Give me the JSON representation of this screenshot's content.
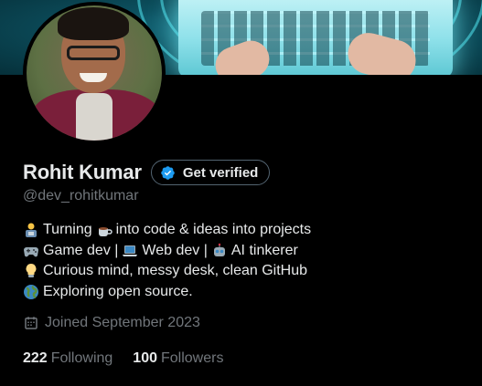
{
  "profile": {
    "display_name": "Rohit Kumar",
    "verify_label": "Get verified",
    "handle": "@dev_rohitkumar",
    "bio": [
      {
        "icon": "developer-emoji-icon",
        "text": "Turning",
        "icon2": "coffee-emoji-icon",
        "text2": "into code & ideas into projects"
      },
      {
        "icon": "game-controller-emoji-icon",
        "text": "Game dev |",
        "icon2": "laptop-emoji-icon",
        "text2": "Web dev |",
        "icon3": "robot-emoji-icon",
        "text3": "AI tinkerer"
      },
      {
        "icon": "lightbulb-emoji-icon",
        "text": "Curious mind, messy desk, clean GitHub"
      },
      {
        "icon": "globe-emoji-icon",
        "text": "Exploring open source."
      }
    ],
    "joined": "Joined September 2023",
    "following_count": "222",
    "following_label": "Following",
    "followers_count": "100",
    "followers_label": "Followers"
  },
  "colors": {
    "background": "#000000",
    "primary_text": "#e7e9ea",
    "secondary_text": "#71767b",
    "verified_blue": "#1d9bf0",
    "banner_teal": "#1e7f92",
    "button_border": "#536471"
  }
}
